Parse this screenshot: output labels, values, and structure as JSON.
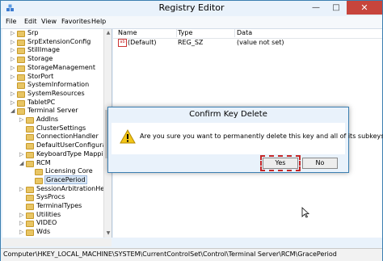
{
  "window": {
    "title": "Registry Editor",
    "close_glyph": "✕",
    "minimize_glyph": "—",
    "maximize_glyph": "□"
  },
  "menu": [
    "File",
    "Edit",
    "View",
    "Favorites",
    "Help"
  ],
  "tree": [
    {
      "label": "Srp",
      "expander": "▷"
    },
    {
      "label": "SrpExtensionConfig",
      "expander": "▷"
    },
    {
      "label": "StillImage",
      "expander": "▷"
    },
    {
      "label": "Storage",
      "expander": "▷"
    },
    {
      "label": "StorageManagement",
      "expander": "▷"
    },
    {
      "label": "StorPort",
      "expander": "▷"
    },
    {
      "label": "SystemInformation",
      "expander": ""
    },
    {
      "label": "SystemResources",
      "expander": "▷"
    },
    {
      "label": "TabletPC",
      "expander": "▷"
    },
    {
      "label": "Terminal Server",
      "expander": "◢"
    },
    {
      "label": "AddIns",
      "expander": "▷"
    },
    {
      "label": "ClusterSettings",
      "expander": ""
    },
    {
      "label": "ConnectionHandler",
      "expander": ""
    },
    {
      "label": "DefaultUserConfiguration",
      "expander": ""
    },
    {
      "label": "KeyboardType Mapping",
      "expander": "▷"
    },
    {
      "label": "RCM",
      "expander": "◢"
    },
    {
      "label": "Licensing Core",
      "expander": ""
    },
    {
      "label": "GracePeriod",
      "expander": ""
    },
    {
      "label": "SessionArbitrationHelper",
      "expander": "▷"
    },
    {
      "label": "SysProcs",
      "expander": ""
    },
    {
      "label": "TerminalTypes",
      "expander": ""
    },
    {
      "label": "Utilities",
      "expander": "▷"
    },
    {
      "label": "VIDEO",
      "expander": "▷"
    },
    {
      "label": "Wds",
      "expander": "▷"
    }
  ],
  "tree_selected": "GracePeriod",
  "columns": {
    "name": "Name",
    "type": "Type",
    "data": "Data"
  },
  "values": [
    {
      "icon": "ab",
      "name": "(Default)",
      "type": "REG_SZ",
      "data": "(value not set)"
    }
  ],
  "status_path": "Computer\\HKEY_LOCAL_MACHINE\\SYSTEM\\CurrentControlSet\\Control\\Terminal Server\\RCM\\GracePeriod",
  "dialog": {
    "title": "Confirm Key Delete",
    "message": "Are you sure you want to permanently delete this key and all of its subkeys?",
    "yes_label": "Yes",
    "no_label": "No",
    "icon": "warning-icon"
  },
  "colors": {
    "accent": "#3c7fb1",
    "close": "#c7453c",
    "highlight_outline": "#c52727"
  }
}
